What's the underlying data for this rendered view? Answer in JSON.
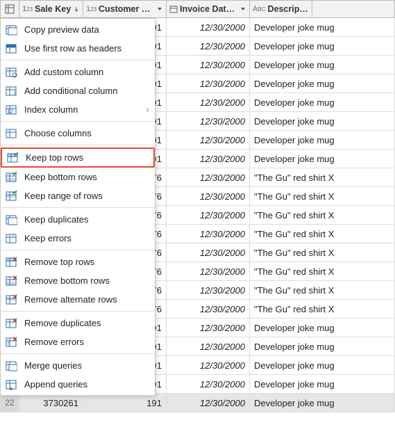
{
  "columns": {
    "rowselector_icon": "table-icon",
    "sale_key": {
      "type_prefix": "1",
      "type_suffix": "23",
      "label": "Sale Key",
      "has_sort": true
    },
    "customer_key": {
      "type_prefix": "1",
      "type_suffix": "23",
      "label": "Customer Key",
      "has_sort": false
    },
    "invoice_date": {
      "type_icon": "calendar",
      "label": "Invoice Date Key",
      "has_sort": false
    },
    "description": {
      "type_prefix": "A",
      "type_suffix": "BC",
      "label": "Description",
      "has_sort": false
    }
  },
  "visible_row_number": "22",
  "visible_sale_key": "3730261",
  "rows": [
    {
      "cust": "191",
      "date": "12/30/2000",
      "desc": "Developer joke mug"
    },
    {
      "cust": "191",
      "date": "12/30/2000",
      "desc": "Developer joke mug"
    },
    {
      "cust": "191",
      "date": "12/30/2000",
      "desc": "Developer joke mug"
    },
    {
      "cust": "191",
      "date": "12/30/2000",
      "desc": "Developer joke mug"
    },
    {
      "cust": "191",
      "date": "12/30/2000",
      "desc": "Developer joke mug"
    },
    {
      "cust": "191",
      "date": "12/30/2000",
      "desc": "Developer joke mug"
    },
    {
      "cust": "191",
      "date": "12/30/2000",
      "desc": "Developer joke mug"
    },
    {
      "cust": "191",
      "date": "12/30/2000",
      "desc": "Developer joke mug"
    },
    {
      "cust": "376",
      "date": "12/30/2000",
      "desc": "\"The Gu\" red shirt X"
    },
    {
      "cust": "376",
      "date": "12/30/2000",
      "desc": "\"The Gu\" red shirt X"
    },
    {
      "cust": "376",
      "date": "12/30/2000",
      "desc": "\"The Gu\" red shirt X"
    },
    {
      "cust": "376",
      "date": "12/30/2000",
      "desc": "\"The Gu\" red shirt X"
    },
    {
      "cust": "376",
      "date": "12/30/2000",
      "desc": "\"The Gu\" red shirt X"
    },
    {
      "cust": "376",
      "date": "12/30/2000",
      "desc": "\"The Gu\" red shirt X"
    },
    {
      "cust": "376",
      "date": "12/30/2000",
      "desc": "\"The Gu\" red shirt X"
    },
    {
      "cust": "376",
      "date": "12/30/2000",
      "desc": "\"The Gu\" red shirt X"
    },
    {
      "cust": "191",
      "date": "12/30/2000",
      "desc": "Developer joke mug"
    },
    {
      "cust": "191",
      "date": "12/30/2000",
      "desc": "Developer joke mug"
    },
    {
      "cust": "191",
      "date": "12/30/2000",
      "desc": "Developer joke mug"
    },
    {
      "cust": "191",
      "date": "12/30/2000",
      "desc": "Developer joke mug"
    },
    {
      "cust": "191",
      "date": "12/30/2000",
      "desc": "Developer joke mug"
    }
  ],
  "menu": {
    "groups": [
      [
        {
          "key": "copy_preview",
          "label": "Copy preview data",
          "icon": "copy-table"
        },
        {
          "key": "first_row_headers",
          "label": "Use first row as headers",
          "icon": "table-header"
        }
      ],
      [
        {
          "key": "add_custom_col",
          "label": "Add custom column",
          "icon": "table-gear"
        },
        {
          "key": "add_conditional_col",
          "label": "Add conditional column",
          "icon": "table-branch"
        },
        {
          "key": "index_column",
          "label": "Index column",
          "icon": "table-index",
          "submenu": true
        }
      ],
      [
        {
          "key": "choose_columns",
          "label": "Choose columns",
          "icon": "table-choose"
        }
      ],
      [
        {
          "key": "keep_top",
          "label": "Keep top rows",
          "icon": "keep-top",
          "highlight": true
        },
        {
          "key": "keep_bottom",
          "label": "Keep bottom rows",
          "icon": "keep-bottom"
        },
        {
          "key": "keep_range",
          "label": "Keep range of rows",
          "icon": "keep-range"
        }
      ],
      [
        {
          "key": "keep_dupes",
          "label": "Keep duplicates",
          "icon": "keep-dup"
        },
        {
          "key": "keep_errors",
          "label": "Keep errors",
          "icon": "keep-err"
        }
      ],
      [
        {
          "key": "remove_top",
          "label": "Remove top rows",
          "icon": "remove-top"
        },
        {
          "key": "remove_bottom",
          "label": "Remove bottom rows",
          "icon": "remove-bottom"
        },
        {
          "key": "remove_alternate",
          "label": "Remove alternate rows",
          "icon": "remove-alt"
        }
      ],
      [
        {
          "key": "remove_dupes",
          "label": "Remove duplicates",
          "icon": "remove-dup"
        },
        {
          "key": "remove_errors",
          "label": "Remove errors",
          "icon": "remove-err"
        }
      ],
      [
        {
          "key": "merge_queries",
          "label": "Merge queries",
          "icon": "merge"
        },
        {
          "key": "append_queries",
          "label": "Append queries",
          "icon": "append"
        }
      ]
    ]
  }
}
